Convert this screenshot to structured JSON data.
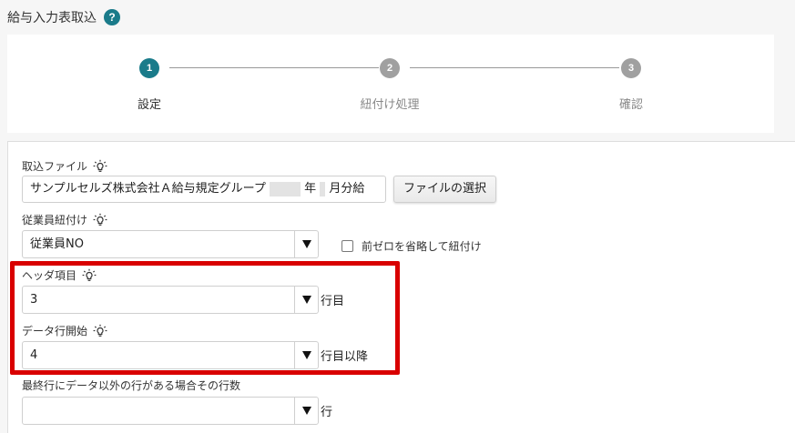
{
  "page": {
    "title": "給与入力表取込",
    "help": "?"
  },
  "stepper": {
    "steps": [
      {
        "number": "1",
        "label": "設定",
        "active": true
      },
      {
        "number": "2",
        "label": "紐付け処理",
        "active": false
      },
      {
        "number": "3",
        "label": "確認",
        "active": false
      }
    ]
  },
  "form": {
    "import_file": {
      "label": "取込ファイル",
      "value_prefix": "サンプルセルズ株式会社Ａ給与規定グループ",
      "value_year": "年",
      "value_month": "月分給",
      "select_button": "ファイルの選択"
    },
    "employee_link": {
      "label": "従業員紐付け",
      "value": "従業員NO",
      "checkbox_label": "前ゼロを省略して紐付け",
      "checked": false
    },
    "header_row": {
      "label": "ヘッダ項目",
      "value": "3",
      "suffix": "行目"
    },
    "data_start": {
      "label": "データ行開始",
      "value": "4",
      "suffix": "行目以降"
    },
    "trailing_rows": {
      "label": "最終行にデータ以外の行がある場合その行数",
      "value": "",
      "suffix": "行"
    }
  },
  "colors": {
    "accent": "#1a7b8a",
    "inactive_step": "#a0a0a0",
    "highlight": "#d90000"
  }
}
